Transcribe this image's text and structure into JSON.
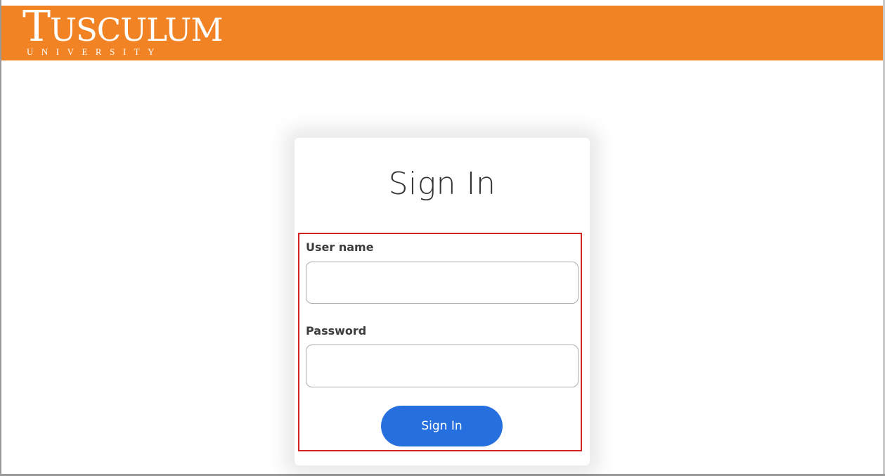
{
  "header": {
    "brand_color": "#f28325",
    "logo": {
      "initial": "T",
      "rest": "USCULUM",
      "subtitle": "UNIVERSITY"
    }
  },
  "login": {
    "title": "Sign In",
    "username_label": "User name",
    "username_value": "",
    "password_label": "Password",
    "password_value": "",
    "submit_label": "Sign In",
    "button_color": "#2570de",
    "highlight_color": "#d32222"
  }
}
